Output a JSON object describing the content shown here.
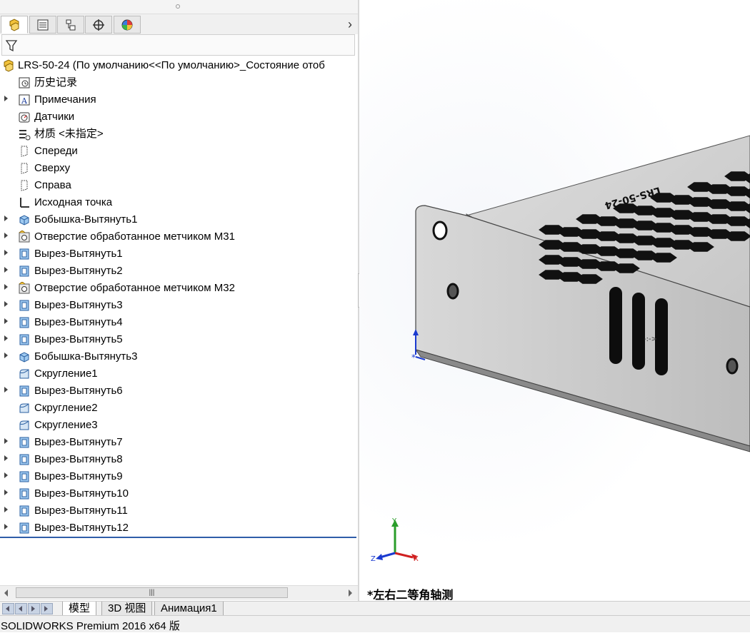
{
  "feature_manager": {
    "tabs": [
      "feature-manager-icon",
      "property-manager-icon",
      "configuration-manager-icon",
      "dimxpert-icon",
      "display-manager-icon"
    ],
    "filter_icon": "filter-icon",
    "root": {
      "label": "LRS-50-24  (По умолчанию<<По умолчанию>_Состояние отоб",
      "icon": "part-icon"
    },
    "items": [
      {
        "label": "历史记录",
        "icon": "history-icon",
        "expandable": false
      },
      {
        "label": "Примечания",
        "icon": "annotations-icon",
        "expandable": true
      },
      {
        "label": "Датчики",
        "icon": "sensors-icon",
        "expandable": false
      },
      {
        "label": "材质 <未指定>",
        "icon": "material-icon",
        "expandable": false
      },
      {
        "label": "Спереди",
        "icon": "plane-icon",
        "expandable": false
      },
      {
        "label": "Сверху",
        "icon": "plane-icon",
        "expandable": false
      },
      {
        "label": "Справа",
        "icon": "plane-icon",
        "expandable": false
      },
      {
        "label": "Исходная точка",
        "icon": "origin-icon",
        "expandable": false
      },
      {
        "label": "Бобышка-Вытянуть1",
        "icon": "boss-extrude-icon",
        "expandable": true
      },
      {
        "label": "Отверстие обработанное метчиком M31",
        "icon": "hole-wizard-icon",
        "expandable": true
      },
      {
        "label": "Вырез-Вытянуть1",
        "icon": "cut-extrude-icon",
        "expandable": true
      },
      {
        "label": "Вырез-Вытянуть2",
        "icon": "cut-extrude-icon",
        "expandable": true
      },
      {
        "label": "Отверстие обработанное метчиком M32",
        "icon": "hole-wizard-icon",
        "expandable": true
      },
      {
        "label": "Вырез-Вытянуть3",
        "icon": "cut-extrude-icon",
        "expandable": true
      },
      {
        "label": "Вырез-Вытянуть4",
        "icon": "cut-extrude-icon",
        "expandable": true
      },
      {
        "label": "Вырез-Вытянуть5",
        "icon": "cut-extrude-icon",
        "expandable": true
      },
      {
        "label": "Бобышка-Вытянуть3",
        "icon": "boss-extrude-icon",
        "expandable": true
      },
      {
        "label": "Скругление1",
        "icon": "fillet-icon",
        "expandable": false
      },
      {
        "label": "Вырез-Вытянуть6",
        "icon": "cut-extrude-icon",
        "expandable": true
      },
      {
        "label": "Скругление2",
        "icon": "fillet-icon",
        "expandable": false
      },
      {
        "label": "Скругление3",
        "icon": "fillet-icon",
        "expandable": false
      },
      {
        "label": "Вырез-Вытянуть7",
        "icon": "cut-extrude-icon",
        "expandable": true
      },
      {
        "label": "Вырез-Вытянуть8",
        "icon": "cut-extrude-icon",
        "expandable": true
      },
      {
        "label": "Вырез-Вытянуть9",
        "icon": "cut-extrude-icon",
        "expandable": true
      },
      {
        "label": "Вырез-Вытянуть10",
        "icon": "cut-extrude-icon",
        "expandable": true
      },
      {
        "label": "Вырез-Вытянуть11",
        "icon": "cut-extrude-icon",
        "expandable": true
      },
      {
        "label": "Вырез-Вытянуть12",
        "icon": "cut-extrude-icon",
        "expandable": true
      }
    ]
  },
  "viewport": {
    "view_name": "*左右二等角轴测",
    "part_text": "LRS-50-24",
    "triad": {
      "x": "X",
      "y": "Y",
      "z": "Z"
    }
  },
  "bottom_tabs": [
    "模型",
    "3D 视图",
    "Анимация1"
  ],
  "status_bar": {
    "text": "SOLIDWORKS Premium 2016 x64 版"
  },
  "colors": {
    "accent": "#2f5da8",
    "sheet_metal": "#c9c9c9",
    "hole": "#111111"
  }
}
